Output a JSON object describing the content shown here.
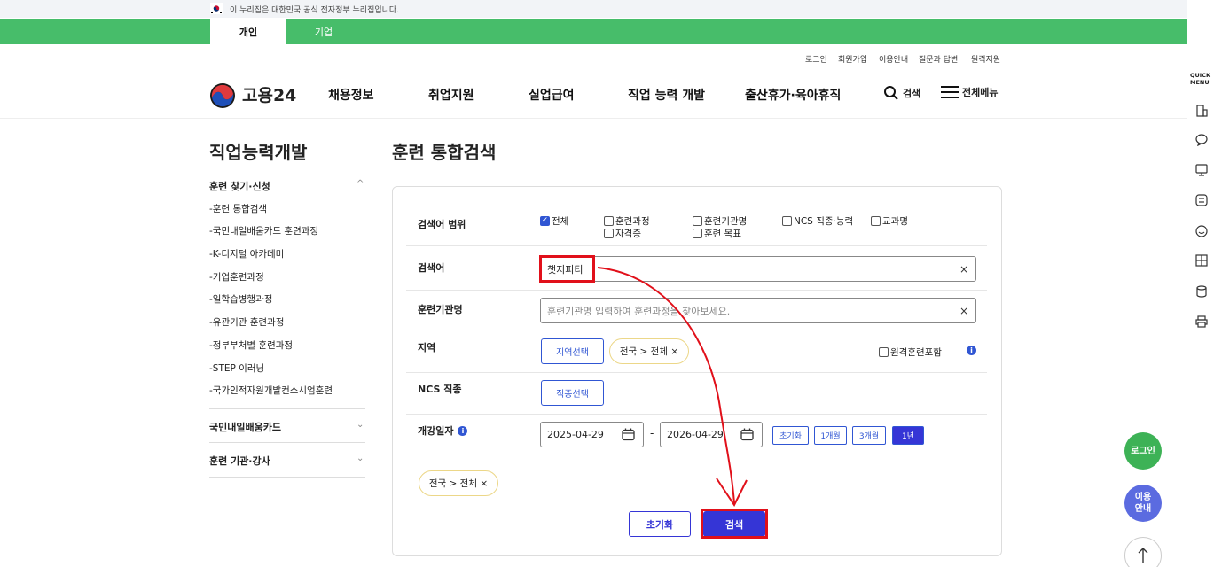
{
  "gov_banner": {
    "text": "이 누리집은 대한민국 공식 전자정부 누리집입니다."
  },
  "top_tabs": [
    {
      "label": "개인"
    },
    {
      "label": "기업"
    }
  ],
  "util_links": [
    {
      "label": "로그인"
    },
    {
      "label": "회원가입"
    },
    {
      "label": "이용안내"
    },
    {
      "label": "질문과 답변"
    },
    {
      "label": "원격지원"
    }
  ],
  "logo": {
    "text": "고용24"
  },
  "gnb": [
    {
      "label": "채용정보"
    },
    {
      "label": "취업지원"
    },
    {
      "label": "실업급여"
    },
    {
      "label": "직업 능력 개발"
    },
    {
      "label": "출산휴가·육아휴직"
    }
  ],
  "search_label": "검색",
  "menu_label": "전체메뉴",
  "lnb": {
    "title": "직업능력개발",
    "section1": "훈련 찾기·신청",
    "items": [
      {
        "label": "-훈련 통합검색"
      },
      {
        "label": "-국민내일배움카드 훈련과정"
      },
      {
        "label": "-K-디지털 아카데미"
      },
      {
        "label": "-기업훈련과정"
      },
      {
        "label": "-일학습병행과정"
      },
      {
        "label": "-유관기관 훈련과정"
      },
      {
        "label": "-정부부처별 훈련과정"
      },
      {
        "label": "-STEP 이러닝"
      },
      {
        "label": "-국가인적자원개발컨소시엄훈련"
      }
    ],
    "section2": "국민내일배움카드",
    "section3": "훈련 기관·강사"
  },
  "page_title": "훈련 통합검색",
  "form": {
    "scope_label": "검색어 범위",
    "scope_options": [
      {
        "label": "전체",
        "checked": true
      },
      {
        "label": "훈련과정",
        "checked": false
      },
      {
        "label": "훈련기관명",
        "checked": false
      },
      {
        "label": "NCS 직종·능력",
        "checked": false
      },
      {
        "label": "교과명",
        "checked": false
      },
      {
        "label": "자격증",
        "checked": false
      },
      {
        "label": "훈련 목표",
        "checked": false
      }
    ],
    "keyword_label": "검색어",
    "keyword_value": "챗지피티",
    "org_label": "훈련기관명",
    "org_placeholder": "훈련기관명 입력하여 훈련과정을 찾아보세요.",
    "region_label": "지역",
    "region_button": "지역선택",
    "region_chip": "전국 > 전체 ×",
    "remote_label": "원격훈련포함",
    "ncs_label": "NCS 직종",
    "ncs_button": "직종선택",
    "date_label": "개강일자",
    "date_from": "2025-04-29",
    "date_sep": "-",
    "date_to": "2026-04-29",
    "period_buttons": [
      {
        "label": "초기화"
      },
      {
        "label": "1개월"
      },
      {
        "label": "3개월"
      },
      {
        "label": "1년"
      }
    ],
    "selected_chip": "전국 > 전체 ×",
    "reset_button": "초기화",
    "search_button": "검색"
  },
  "quick_menu": {
    "title_line1": "QUICK",
    "title_line2": "MENU"
  },
  "fab": {
    "login": "로그인",
    "guide_line1": "이용",
    "guide_line2": "안내"
  },
  "colors": {
    "green": "#47bd6a",
    "blue": "#3056d3",
    "red": "#e1101a",
    "chip_border": "#ecd788"
  }
}
